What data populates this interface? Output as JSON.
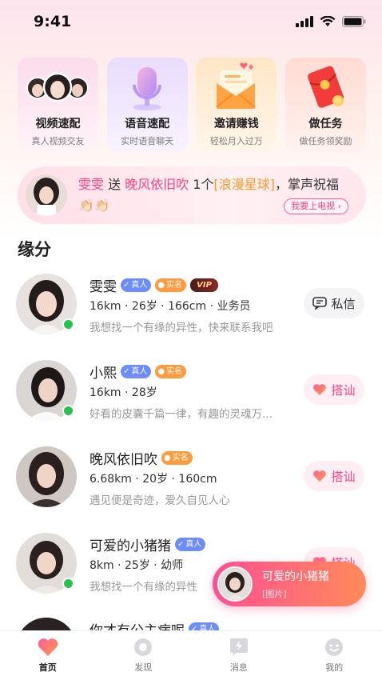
{
  "status_bar": {
    "time": "9:41"
  },
  "features": [
    {
      "title": "视频速配",
      "subtitle": "真人视频交友"
    },
    {
      "title": "语音速配",
      "subtitle": "实时语音聊天"
    },
    {
      "title": "邀请赚钱",
      "subtitle": "轻松月入过万"
    },
    {
      "title": "做任务",
      "subtitle": "做任务领奖励"
    }
  ],
  "banner": {
    "sender": "雯雯",
    "send_word": "送",
    "receiver": "晚风依旧吹",
    "count": "1个",
    "gift": "[浪漫星球]",
    "tail": "，掌声祝福👏🏻👏🏻",
    "button": "我要上电视 ›"
  },
  "section_title": "缘分",
  "users": [
    {
      "name": "雯雯",
      "badges": [
        "真人",
        "实名",
        "VIP"
      ],
      "info": "16km · 26岁 · 166cm · 业务员",
      "bio": "我想找一个有缘的异性，快来联系我吧",
      "action": "私信",
      "online": true
    },
    {
      "name": "小熙",
      "badges": [
        "真人",
        "实名"
      ],
      "info": "16km · 28岁",
      "bio": "好看的皮囊千篇一律，有趣的灵魂万...",
      "action": "搭讪",
      "online": true
    },
    {
      "name": "晚风依旧吹",
      "badges": [
        "实名"
      ],
      "info": "6.68km · 20岁 · 160cm",
      "bio": "遇见便是奇迹，爱久自见人心",
      "action": "搭讪",
      "online": false
    },
    {
      "name": "可爱的小猪猪",
      "badges": [
        "真人"
      ],
      "info": "8km · 25岁 · 幼师",
      "bio": "我想找一个有缘的异性",
      "action": "搭讪",
      "online": true
    },
    {
      "name": "你才有公主病呢",
      "badges": [
        "真人"
      ],
      "info": "",
      "bio": "",
      "action": "",
      "online": false
    }
  ],
  "toast": {
    "name": "可爱的小猪猪",
    "message": "[图片]"
  },
  "tabs": [
    {
      "label": "首页",
      "active": true
    },
    {
      "label": "发现",
      "active": false
    },
    {
      "label": "消息",
      "active": false
    },
    {
      "label": "我的",
      "active": false
    }
  ],
  "colors": {
    "accent": "#ff3f80",
    "gold": "#ff9a2a",
    "online": "#27c24c",
    "real_badge": "#6d8dff",
    "verified_badge": "#ff9a3d"
  }
}
